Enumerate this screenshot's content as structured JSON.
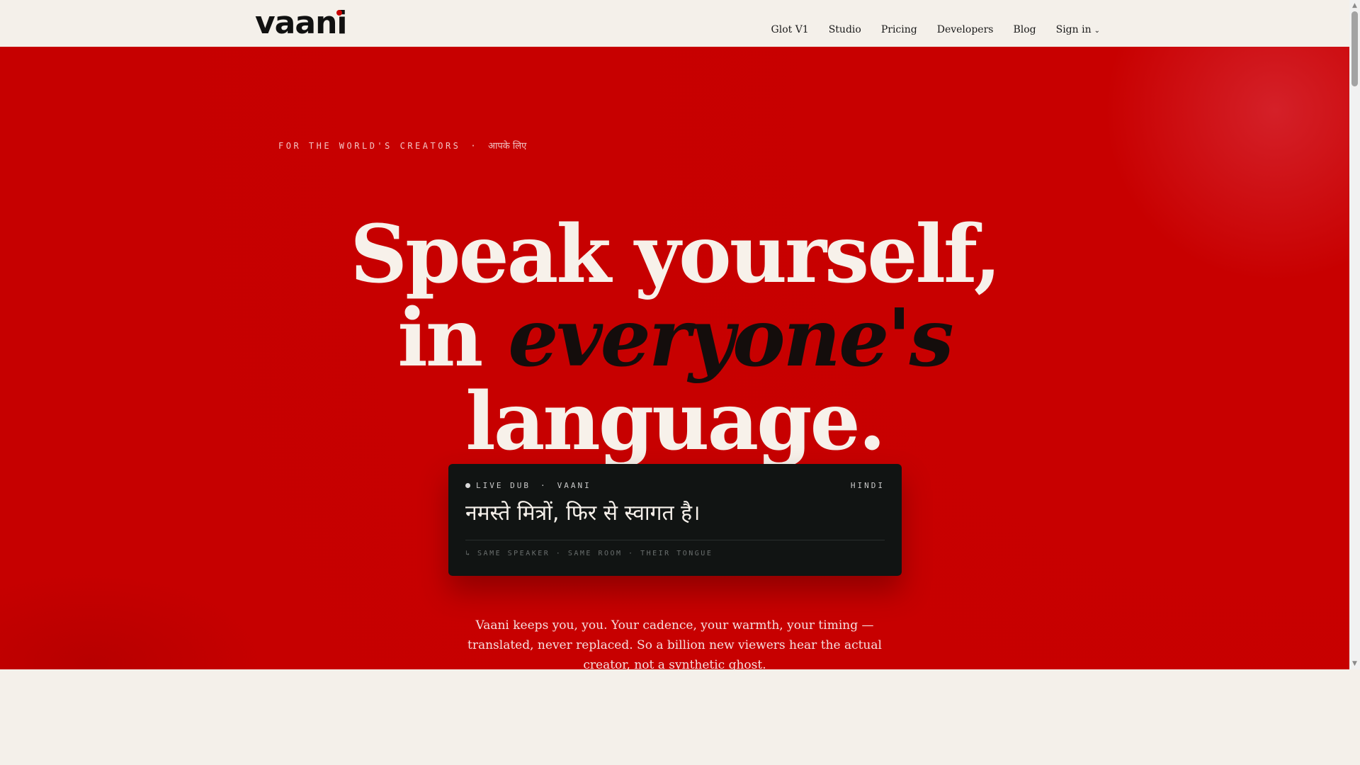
{
  "nav": {
    "logo": "vaani",
    "links": [
      "Glot V1",
      "Studio",
      "Pricing",
      "Developers",
      "Blog",
      "Sign in"
    ]
  },
  "hero": {
    "eyebrow_en": "FOR THE WORLD'S CREATORS",
    "eyebrow_sep": "·",
    "eyebrow_hi": "आपके लिए",
    "headline_line1": "Speak yourself,",
    "headline_line2_plain": "in",
    "headline_line2_em": "everyone's",
    "headline_line3": "language."
  },
  "card": {
    "tag": "LIVE DUB",
    "sep": "·",
    "brand": "VAANI",
    "language": "HINDI",
    "text": "नमस्ते मित्रों, फिर से स्वागत है।",
    "footer": "↳ SAME SPEAKER · SAME ROOM · THEIR TONGUE"
  },
  "subtext": {
    "line1": "Vaani keeps you, you. Your cadence, your warmth, your timing —",
    "line2": "translated, never replaced. So a billion new viewers hear the actual",
    "line3": "creator, not a synthetic ghost."
  },
  "colors": {
    "hero_red": "#c80000",
    "card_bg": "#111413",
    "page_bg": "#f4f0ea"
  }
}
